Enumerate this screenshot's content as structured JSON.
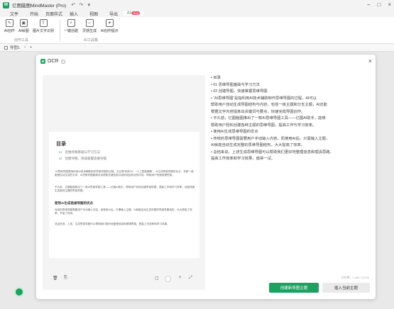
{
  "app": {
    "logo": "M",
    "title": "亿图脑图MindMaster (Pro)"
  },
  "menu": {
    "tabs": [
      "文件",
      "开始",
      "页面样式",
      "插入",
      "视图",
      "导出",
      "AI"
    ],
    "ai_badge": "New"
  },
  "ribbon": {
    "buttons": [
      "AI创作",
      "AI绘图",
      "图片文字识别",
      "一键创建",
      "灵感生成",
      "AI创作提示"
    ],
    "groups": [
      "创作工具",
      "AI工具箱"
    ]
  },
  "sheets": {
    "tab": "导图1",
    "add": "+"
  },
  "modal": {
    "title": "OCR",
    "close": "×",
    "preview": {
      "doc_title": "目录",
      "toc": [
        "思维导图基础与学习方法",
        "创建导图，快速掌握思维导图"
      ],
      "para1": "“AI思维导图是指利用AI技术辅助制作思维导图的过程，无论是“制作AI”，“人工智能辅助”，AI生成思维导图的优点，多数一级都是自动生成的文本，AI思维导图能够自动提取关键信息并组织成结构化的内容，帮助用户快速梳理思路。",
      "para2": "不久前，亿图脑图推出了一款AI思维导图工具——亿图AI助手，帮助用户轻松创建思维导图，提高工作和学习效率，还能快速生成各种主题的思维导图。",
      "heading": "使用AI生成思维导图的优点",
      "para3": "传统的思维导图需要用户手动输入内容，而使用AI后，只需输入主题，AI就能自动生成完整的思维导图结构，大大提高了效率，节省了时间。",
      "para4": "总结来说，上述，生成思维导图可以帮助我们更好地整理信息和理清思路，提高工作效率和学习效果。"
    },
    "text_lines": [
      "• 目录",
      "• 01 思维导图基础与学习方法",
      "• 02 创建导图，快速掌握思维导图",
      "• “AI思维导图”是指利用AI技术辅助制作思维导图的过程，AI可以",
      "  帮助用户自动生成导图结构与内容，包括一级主题和分支主题，AI还能",
      "  根据文字内容提炼出关键词与要点，快速完成导图创作。",
      "• 不久前，亿图脑图推出了一款AI思维导图工具——亿图AI助手，能够",
      "  帮助用户轻松创建各种主题的思维导图，提高工作与学习效率。",
      "• 使用AI生成思维导图的优点",
      "• 传统的思维导图需要用户手动输入内容，而使用AI后，只需输入主题，",
      "  AI就能自动生成完整的思维导图结构，大大提高了效率。",
      "• 总结来说，上述生成思维导图可以帮助我们更好地整理信息和理清思路，",
      "  提高工作效率和学习效果，值得一试。"
    ],
    "char_count": "字符数：1,452 / 5,000",
    "primary_button": "创建新导图主题",
    "secondary_button": "插入当前主题"
  }
}
